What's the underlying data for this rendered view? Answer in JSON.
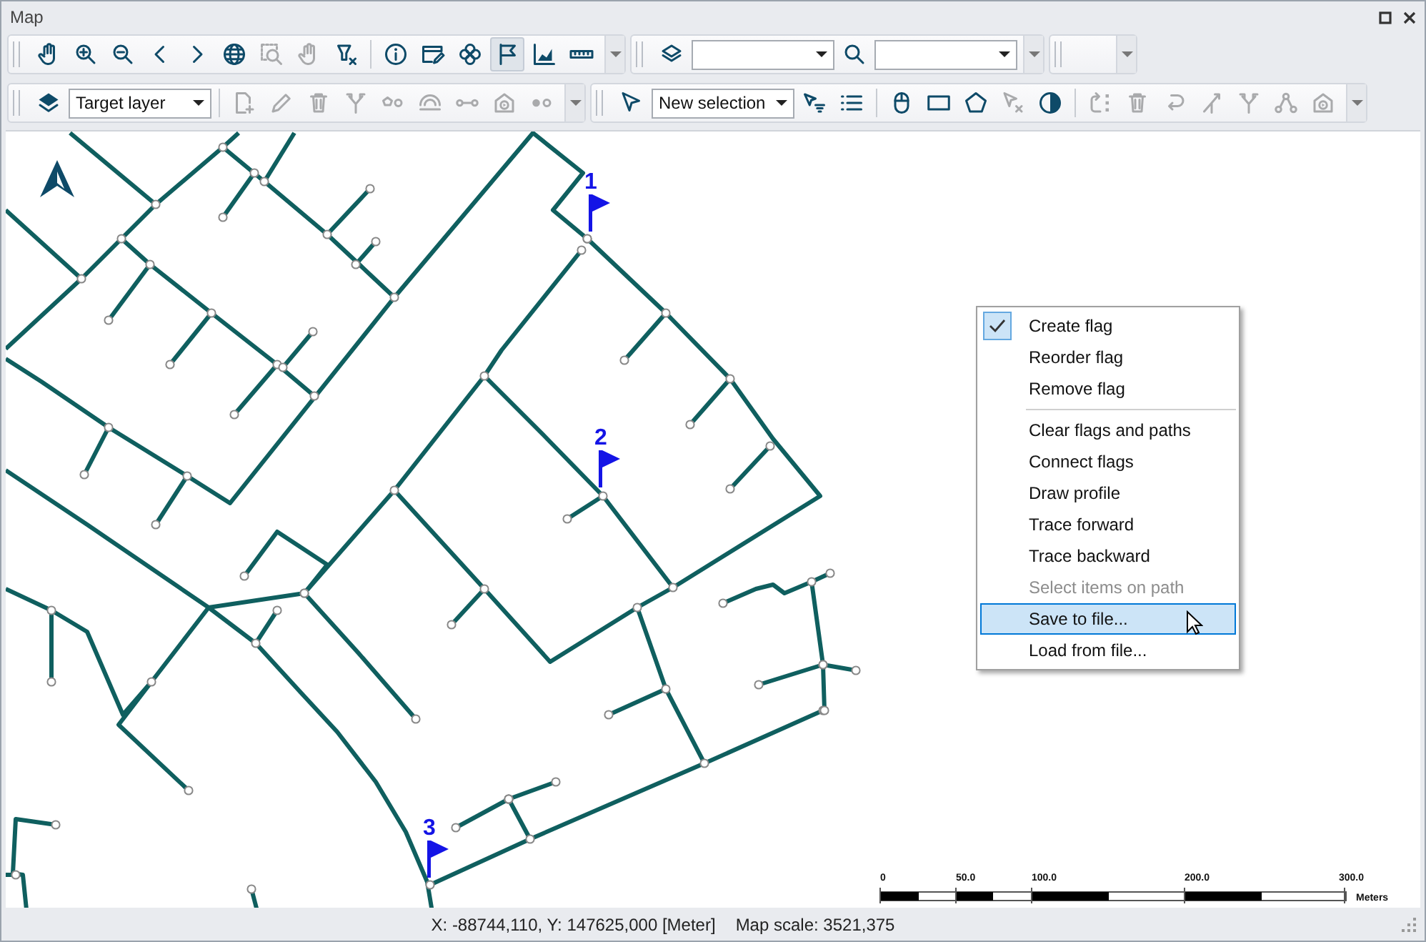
{
  "window": {
    "title": "Map"
  },
  "toolbars": [
    {
      "groups": [
        {
          "items": [
            {
              "kind": "button",
              "disabled": false,
              "selected": false
            },
            {
              "kind": "button",
              "disabled": false,
              "selected": false
            },
            {
              "kind": "button",
              "disabled": false,
              "selected": false
            },
            {
              "kind": "button",
              "disabled": false,
              "selected": false
            },
            {
              "kind": "button",
              "disabled": false,
              "selected": false
            },
            {
              "kind": "button",
              "disabled": false,
              "selected": false
            },
            {
              "kind": "button",
              "disabled": true,
              "selected": false
            },
            {
              "kind": "button",
              "disabled": true,
              "selected": false
            },
            {
              "kind": "button",
              "disabled": false,
              "selected": false
            },
            {
              "kind": "separator"
            },
            {
              "kind": "button",
              "disabled": false,
              "selected": false
            },
            {
              "kind": "button",
              "disabled": false,
              "selected": false
            },
            {
              "kind": "button",
              "disabled": false,
              "selected": false
            },
            {
              "kind": "button",
              "disabled": false,
              "selected": true
            },
            {
              "kind": "button",
              "disabled": false,
              "selected": false
            },
            {
              "kind": "button",
              "disabled": false,
              "selected": false
            },
            {
              "kind": "overflow"
            }
          ]
        },
        {
          "items": [
            {
              "kind": "button",
              "disabled": false,
              "selected": false
            },
            {
              "kind": "dropdown"
            },
            {
              "kind": "button",
              "disabled": false,
              "selected": false
            },
            {
              "kind": "dropdown"
            },
            {
              "kind": "overflow"
            }
          ]
        },
        {
          "items": [
            {
              "kind": "blank"
            },
            {
              "kind": "overflow"
            }
          ]
        }
      ]
    },
    {
      "groups": [
        {
          "items": [
            {
              "kind": "button",
              "disabled": false,
              "selected": false
            },
            {
              "kind": "dropdown",
              "value": "Target layer"
            },
            {
              "kind": "separator"
            },
            {
              "kind": "button",
              "disabled": true,
              "selected": false
            },
            {
              "kind": "button",
              "disabled": true,
              "selected": false
            },
            {
              "kind": "button",
              "disabled": true,
              "selected": false
            },
            {
              "kind": "button",
              "disabled": true,
              "selected": false
            },
            {
              "kind": "button",
              "disabled": true,
              "selected": false
            },
            {
              "kind": "button",
              "disabled": true,
              "selected": false
            },
            {
              "kind": "button",
              "disabled": true,
              "selected": false
            },
            {
              "kind": "button",
              "disabled": true,
              "selected": false
            },
            {
              "kind": "button",
              "disabled": true,
              "selected": false
            },
            {
              "kind": "overflow"
            }
          ]
        },
        {
          "items": [
            {
              "kind": "button",
              "disabled": false,
              "selected": false
            },
            {
              "kind": "dropdown",
              "value": "New selection"
            },
            {
              "kind": "button",
              "disabled": false,
              "selected": false
            },
            {
              "kind": "button",
              "disabled": false,
              "selected": false
            },
            {
              "kind": "separator"
            },
            {
              "kind": "button",
              "disabled": false,
              "selected": false
            },
            {
              "kind": "button",
              "disabled": false,
              "selected": false
            },
            {
              "kind": "button",
              "disabled": false,
              "selected": false
            },
            {
              "kind": "button",
              "disabled": true,
              "selected": false
            },
            {
              "kind": "button",
              "disabled": false,
              "selected": false
            },
            {
              "kind": "separator"
            },
            {
              "kind": "button",
              "disabled": true,
              "selected": false
            },
            {
              "kind": "button",
              "disabled": true,
              "selected": false
            },
            {
              "kind": "button",
              "disabled": true,
              "selected": false
            },
            {
              "kind": "button",
              "disabled": true,
              "selected": false
            },
            {
              "kind": "button",
              "disabled": true,
              "selected": false
            },
            {
              "kind": "button",
              "disabled": true,
              "selected": false
            },
            {
              "kind": "button",
              "disabled": true,
              "selected": false
            },
            {
              "kind": "overflow"
            }
          ]
        }
      ]
    }
  ],
  "map": {
    "flags": [
      {
        "label": "1"
      },
      {
        "label": "2"
      },
      {
        "label": "3"
      }
    ],
    "scale_bar": {
      "ticks": [
        "0",
        "50.0",
        "100.0",
        "200.0",
        "300.0"
      ],
      "unit": "Meters"
    },
    "context_menu": [
      {
        "kind": "item",
        "label": "Create flag",
        "checked": true,
        "disabled": false,
        "selected": false
      },
      {
        "kind": "item",
        "label": "Reorder flag",
        "checked": false,
        "disabled": false,
        "selected": false
      },
      {
        "kind": "item",
        "label": "Remove flag",
        "checked": false,
        "disabled": false,
        "selected": false
      },
      {
        "kind": "separator"
      },
      {
        "kind": "item",
        "label": "Clear flags and paths",
        "checked": false,
        "disabled": false,
        "selected": false
      },
      {
        "kind": "item",
        "label": "Connect flags",
        "checked": false,
        "disabled": false,
        "selected": false
      },
      {
        "kind": "item",
        "label": "Draw profile",
        "checked": false,
        "disabled": false,
        "selected": false
      },
      {
        "kind": "item",
        "label": "Trace forward",
        "checked": false,
        "disabled": false,
        "selected": false
      },
      {
        "kind": "item",
        "label": "Trace backward",
        "checked": false,
        "disabled": false,
        "selected": false
      },
      {
        "kind": "item",
        "label": "Select items on path",
        "checked": false,
        "disabled": true,
        "selected": false
      },
      {
        "kind": "item",
        "label": "Save to file...",
        "checked": false,
        "disabled": false,
        "selected": true
      },
      {
        "kind": "item",
        "label": "Load from file...",
        "checked": false,
        "disabled": false,
        "selected": false
      }
    ]
  },
  "status_bar": {
    "coordinates": "X: -88744,110, Y: 147625,000 [Meter]",
    "map_scale": "Map scale: 3521,375"
  }
}
